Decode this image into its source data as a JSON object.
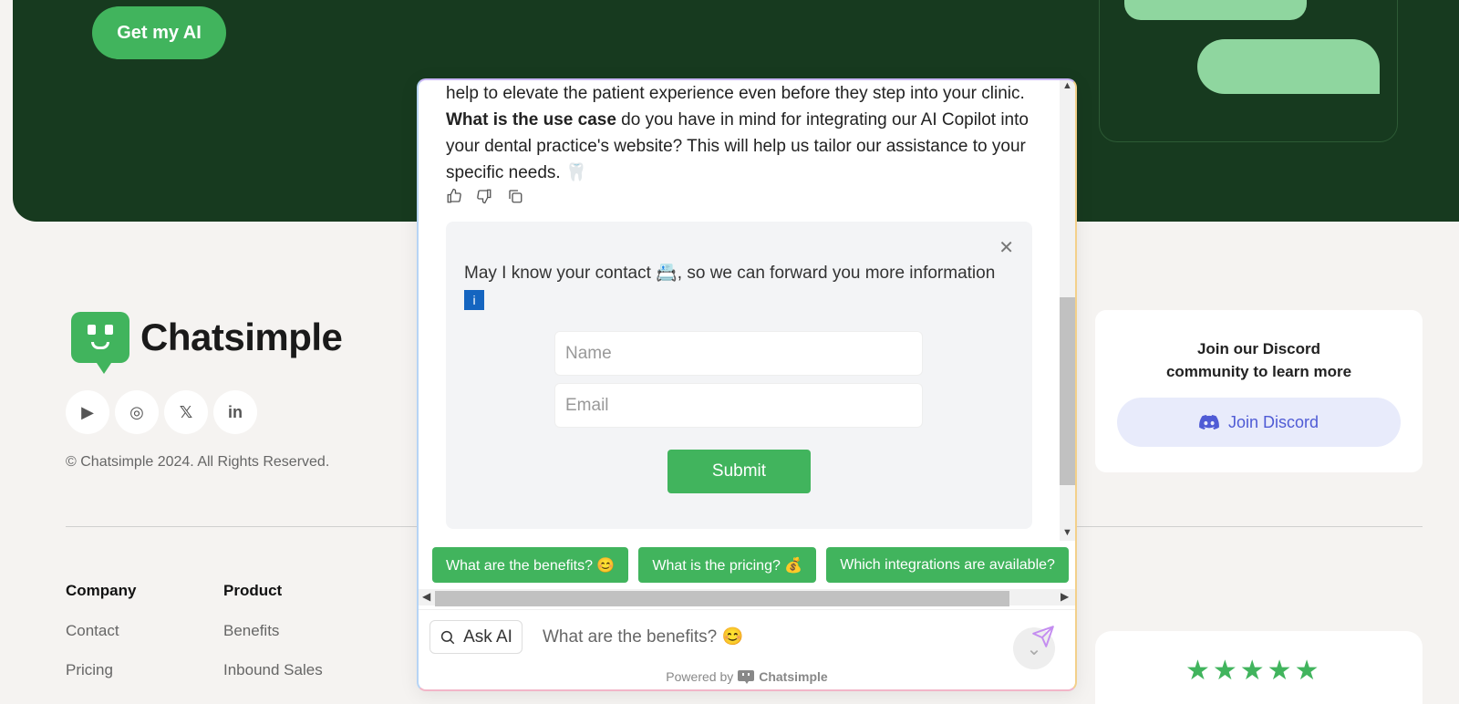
{
  "hero": {
    "cta_label": "Get my AI"
  },
  "brand": {
    "name": "Chatsimple",
    "copyright": "© Chatsimple 2024. All Rights Reserved."
  },
  "socials": [
    {
      "icon": "youtube-icon",
      "glyph": "▶"
    },
    {
      "icon": "instagram-icon",
      "glyph": "◎"
    },
    {
      "icon": "x-icon",
      "glyph": "𝕏"
    },
    {
      "icon": "linkedin-icon",
      "glyph": "in"
    }
  ],
  "footer": {
    "company": {
      "heading": "Company",
      "links": [
        "Contact",
        "Pricing"
      ]
    },
    "product": {
      "heading": "Product",
      "links": [
        "Benefits",
        "Inbound Sales"
      ]
    }
  },
  "discord": {
    "text_line1": "Join our Discord",
    "text_line2": "community to learn more",
    "button_label": "Join Discord"
  },
  "rating": {
    "stars": "★★★★★",
    "value": 5
  },
  "chat": {
    "message_line1": "help to elevate the patient experience even before they step into your clinic.",
    "message_bold": "What is the use case",
    "message_rest": " do you have in mind for integrating our AI Copilot into your dental practice's website? This will help us tailor our assistance to your specific needs. 🦷",
    "contact_prompt": "May I know your contact 📇, so we can forward you more information",
    "info_glyph": "i",
    "name_placeholder": "Name",
    "email_placeholder": "Email",
    "submit_label": "Submit",
    "chips": [
      "What are the benefits? 😊",
      "What is the pricing? 💰",
      "Which integrations are available?"
    ],
    "ask_label": "Ask AI",
    "input_placeholder": "What are the benefits? 😊",
    "powered_prefix": "Powered by",
    "powered_brand": "Chatsimple"
  },
  "colors": {
    "hero_bg": "#173a1f",
    "accent": "#41b45d",
    "discord": "#4f5bd5"
  }
}
